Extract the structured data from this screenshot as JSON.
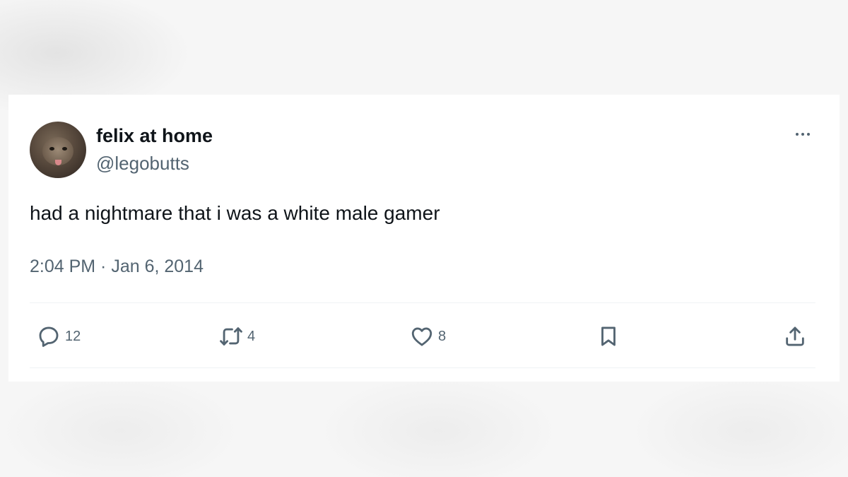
{
  "tweet": {
    "author": {
      "display_name": "felix at home",
      "handle": "@legobutts"
    },
    "text": "had a nightmare that i was a white male gamer",
    "timestamp": "2:04 PM · Jan 6, 2014",
    "actions": {
      "replies": "12",
      "retweets": "4",
      "likes": "8"
    }
  },
  "icons": {
    "more": "more-horizontal-icon",
    "reply": "speech-bubble-icon",
    "retweet": "retweet-arrows-icon",
    "like": "heart-icon",
    "bookmark": "bookmark-icon",
    "share": "share-upload-icon"
  },
  "colors": {
    "text_primary": "#0f1419",
    "text_secondary": "#536471",
    "divider": "#eff3f4"
  }
}
